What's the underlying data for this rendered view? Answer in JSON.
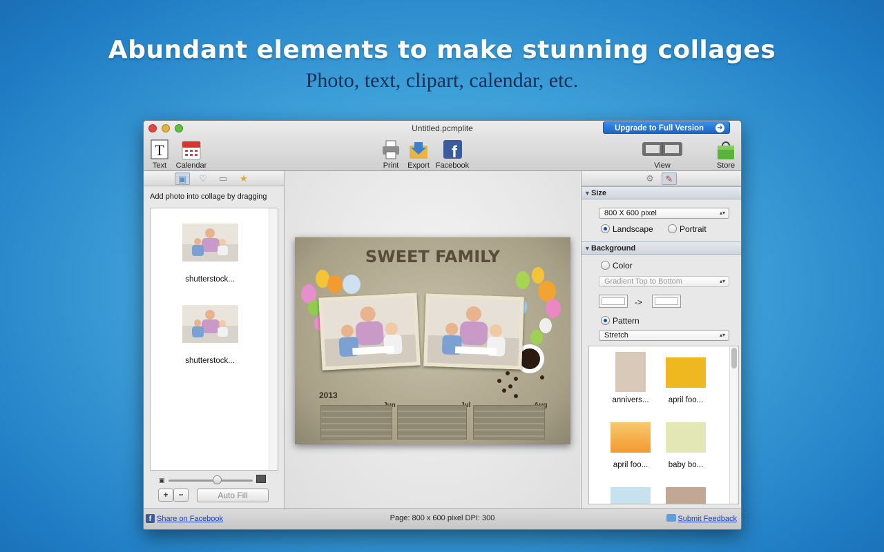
{
  "banner": {
    "headline": "Abundant elements to make stunning collages",
    "subline": "Photo, text, clipart, calendar, etc."
  },
  "window": {
    "title": "Untitled.pcmplite",
    "upgrade": "Upgrade to Full Version"
  },
  "toolbar": {
    "text": "Text",
    "calendar": "Calendar",
    "print": "Print",
    "export": "Export",
    "facebook": "Facebook",
    "view": "View",
    "store": "Store"
  },
  "left_panel": {
    "hint": "Add photo into collage by dragging",
    "photos": [
      {
        "name": "shutterstock..."
      },
      {
        "name": "shutterstock..."
      }
    ],
    "auto_fill": "Auto Fill",
    "add": "+",
    "remove": "−"
  },
  "canvas": {
    "title": "SWEET FAMILY",
    "year": "2013",
    "months": [
      "Jun",
      "Jul",
      "Aug"
    ]
  },
  "right_panel": {
    "size": {
      "header": "Size",
      "preset": "800 X 600 pixel",
      "landscape": "Landscape",
      "portrait": "Portrait",
      "orientation": "Landscape"
    },
    "background": {
      "header": "Background",
      "color": "Color",
      "gradient": "Gradient Top to Bottom",
      "arrow": "->",
      "pattern": "Pattern",
      "fill_mode": "Stretch",
      "selected": "Pattern"
    },
    "patterns": [
      {
        "name": "annivers...",
        "color": "#d9c9b8"
      },
      {
        "name": "april foo...",
        "color": "#f0b820"
      },
      {
        "name": "april foo...",
        "color": "#f3a743"
      },
      {
        "name": "baby bo...",
        "color": "#e3e6b5"
      },
      {
        "name": "",
        "color": "#c5e2ee"
      },
      {
        "name": "",
        "color": "#c2a894"
      }
    ]
  },
  "status": {
    "share": "Share on Facebook",
    "page_info": "Page: 800 x 600 pixel DPI: 300",
    "feedback": "Submit Feedback"
  }
}
